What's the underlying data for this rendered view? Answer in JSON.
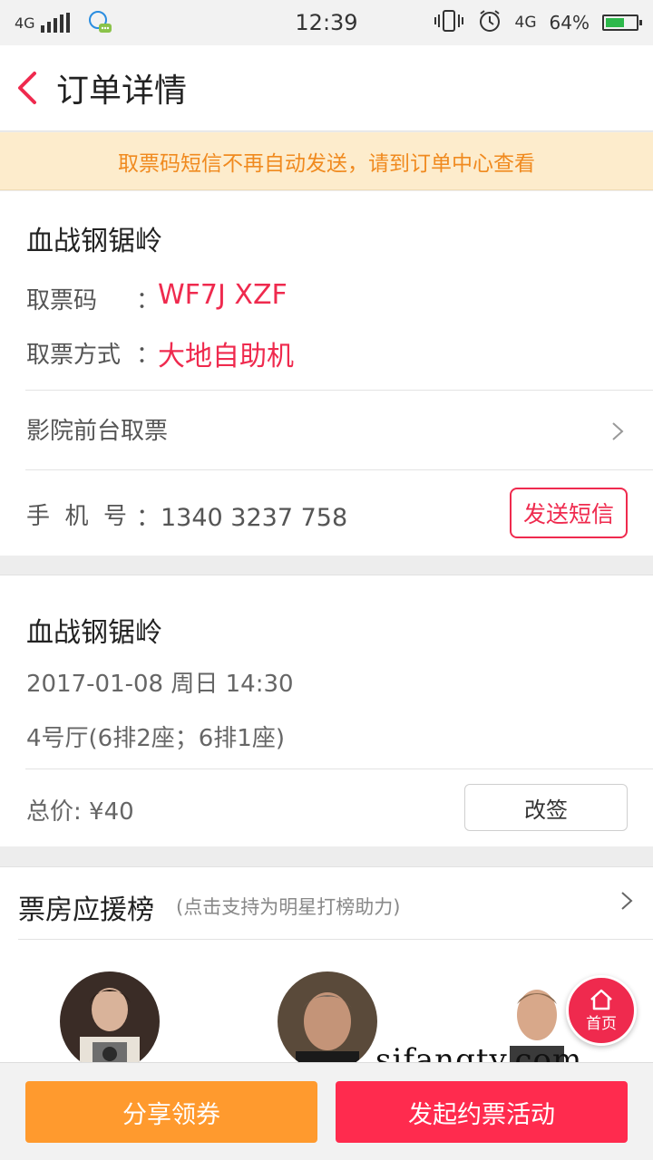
{
  "status_bar": {
    "network": "4G",
    "time": "12:39",
    "network2": "4G",
    "battery": "64%",
    "battery_level": 0.64
  },
  "header": {
    "title": "订单详情"
  },
  "notice": {
    "text": "取票码短信不再自动发送，请到订单中心查看"
  },
  "ticket_card": {
    "movie_title": "血战钢锯岭",
    "code_label": "取票码",
    "code_colon": "：",
    "code_value": "WF7J XZF",
    "method_label": "取票方式",
    "method_colon": "：",
    "method_value": "大地自助机",
    "pickup_label": "影院前台取票",
    "phone_label": "手  机  号",
    "phone_value": "：1340 3237 758",
    "sms_button": "发送短信"
  },
  "order_card": {
    "movie_title": "血战钢锯岭",
    "datetime": "2017-01-08 周日 14:30",
    "seats": "4号厅(6排2座；6排1座)",
    "total": "总价: ¥40",
    "resign_button": "改签"
  },
  "box_office": {
    "title": "票房应援榜",
    "subtitle": "(点击支持为明星打榜助力)"
  },
  "home_fab": {
    "label": "首页"
  },
  "watermark": "sifangtv.com",
  "bottom_bar": {
    "share_button": "分享领券",
    "invite_button": "发起约票活动"
  },
  "colors": {
    "accent": "#ef2a4e",
    "notice_text": "#f08a1f",
    "notice_bg": "#fdeccc",
    "share_btn": "#ff9a2e",
    "invite_btn": "#ff2b4e"
  }
}
